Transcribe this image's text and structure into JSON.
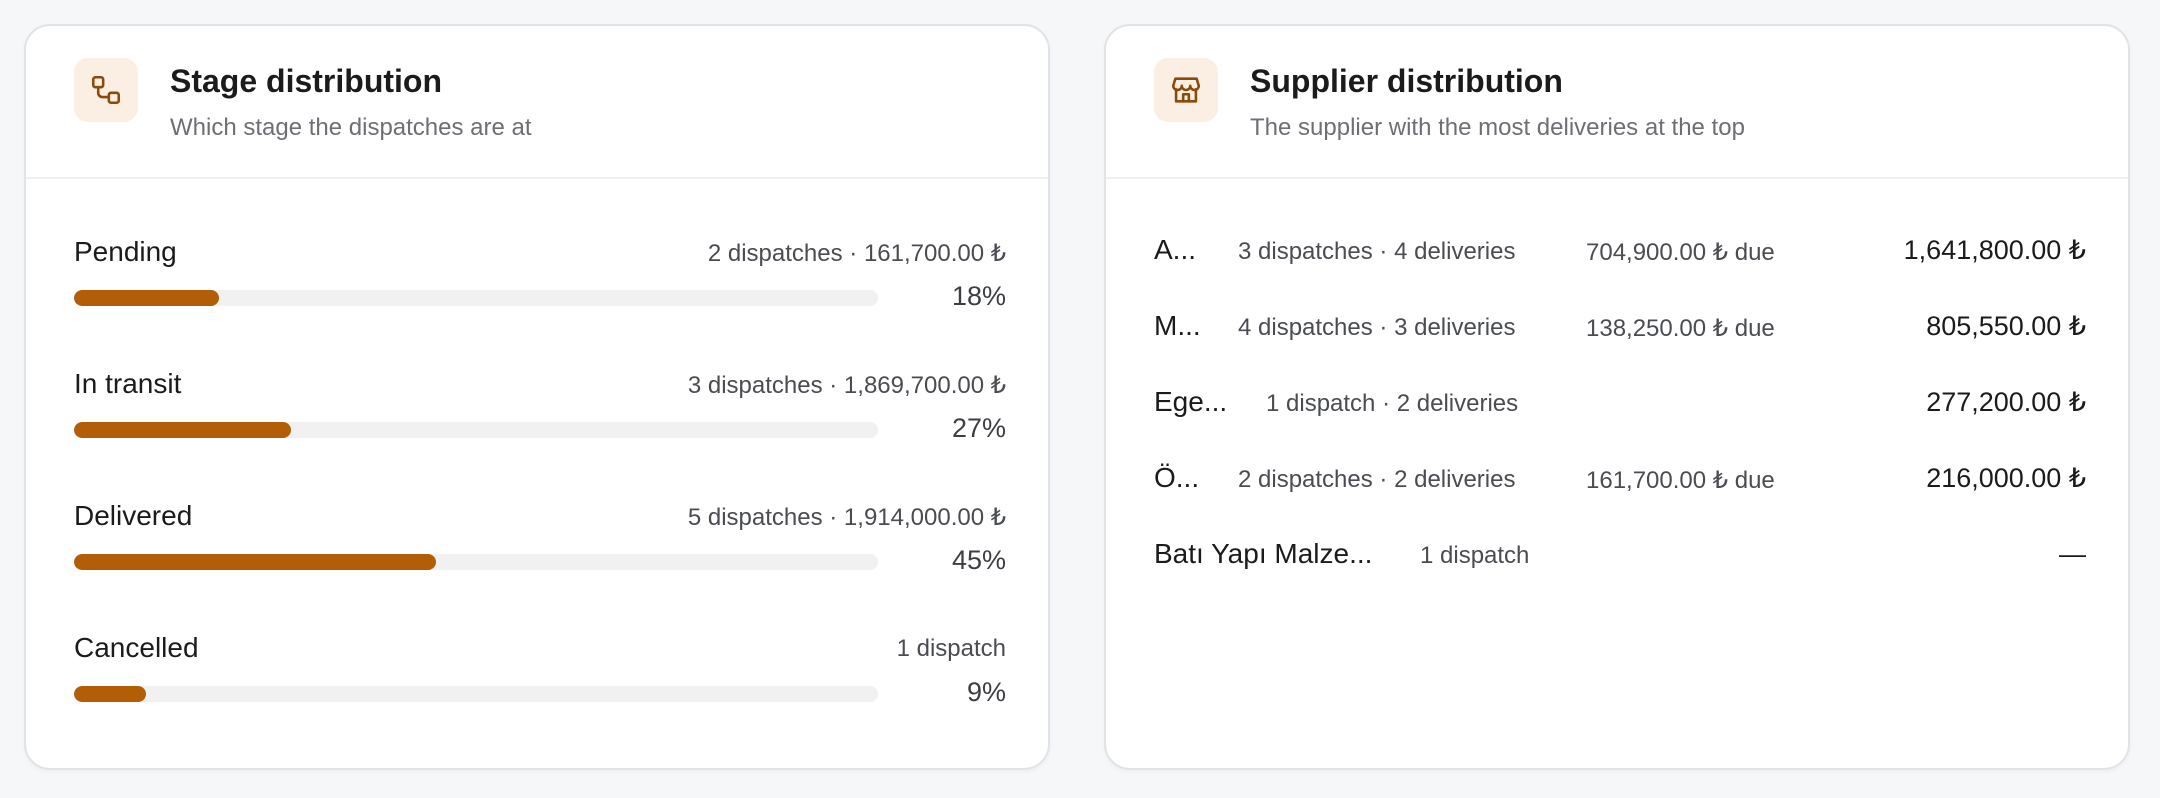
{
  "stage_card": {
    "title": "Stage distribution",
    "subtitle": "Which stage the dispatches are at",
    "icon": "workflow-icon",
    "rows": [
      {
        "label": "Pending",
        "meta": "2 dispatches · 161,700.00 ₺",
        "percent_text": "18%",
        "percent": 18
      },
      {
        "label": "In transit",
        "meta": "3 dispatches · 1,869,700.00 ₺",
        "percent_text": "27%",
        "percent": 27
      },
      {
        "label": "Delivered",
        "meta": "5 dispatches · 1,914,000.00 ₺",
        "percent_text": "45%",
        "percent": 45
      },
      {
        "label": "Cancelled",
        "meta": "1 dispatch",
        "percent_text": "9%",
        "percent": 9
      }
    ]
  },
  "supplier_card": {
    "title": "Supplier distribution",
    "subtitle": "The supplier with the most deliveries at the top",
    "icon": "store-icon",
    "rows": [
      {
        "name": "A...",
        "counts": "3 dispatches · 4 deliveries",
        "due": "704,900.00 ₺ due",
        "amount": "1,641,800.00 ₺"
      },
      {
        "name": "M...",
        "counts": "4 dispatches · 3 deliveries",
        "due": "138,250.00 ₺ due",
        "amount": "805,550.00 ₺"
      },
      {
        "name": "Ege...",
        "counts": "1 dispatch · 2 deliveries",
        "due": "",
        "amount": "277,200.00 ₺"
      },
      {
        "name": "Ö...",
        "counts": "2 dispatches · 2 deliveries",
        "due": "161,700.00 ₺ due",
        "amount": "216,000.00 ₺"
      },
      {
        "name": "Batı Yapı Malze...",
        "counts": "1 dispatch",
        "due": "",
        "amount": "—"
      }
    ]
  },
  "colors": {
    "accent": "#b25e06",
    "icon_bg": "#fbeee2",
    "track": "#f1f1f1"
  }
}
